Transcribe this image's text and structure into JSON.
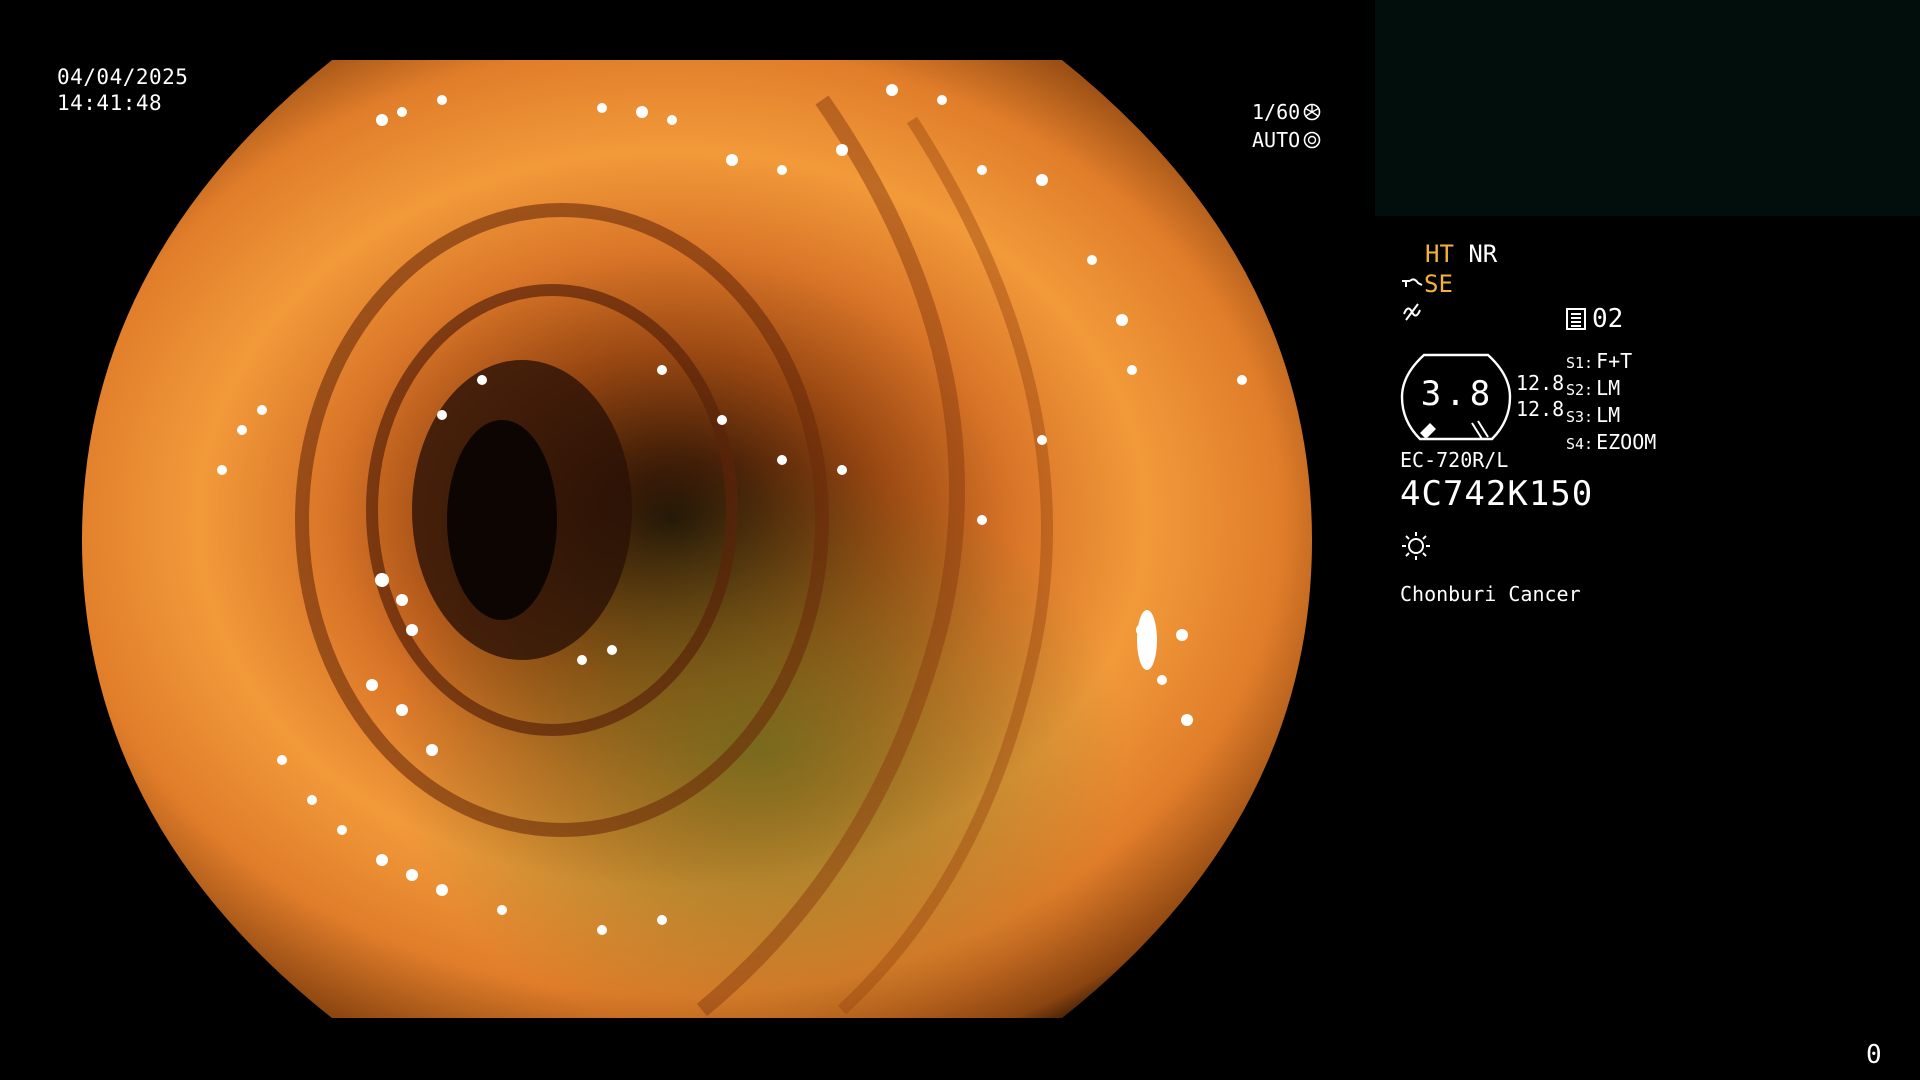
{
  "overlay": {
    "date": "04/04/2025",
    "time": "14:41:48",
    "shutter": "1/60",
    "iris": "AUTO"
  },
  "info": {
    "mode_ht": "HT",
    "mode_nr": "NR",
    "mode_se": "SE",
    "memory": "02",
    "dial_value": "3.8",
    "side_top": "12.8",
    "side_bottom": "12.8",
    "s_buttons": [
      {
        "tag": "S1:",
        "value": "F+T"
      },
      {
        "tag": "S2:",
        "value": "LM"
      },
      {
        "tag": "S3:",
        "value": "LM"
      },
      {
        "tag": "S4:",
        "value": "EZOOM"
      }
    ],
    "model": "EC-720R/L",
    "serial": "4C742K150",
    "hospital": "Chonburi Cancer"
  },
  "footer": {
    "counter": "0"
  },
  "colors": {
    "highlight": "#f6b23e",
    "panel": "#020e0c",
    "tissue_light": "#f29a3a",
    "tissue_dark": "#3a1a08"
  }
}
